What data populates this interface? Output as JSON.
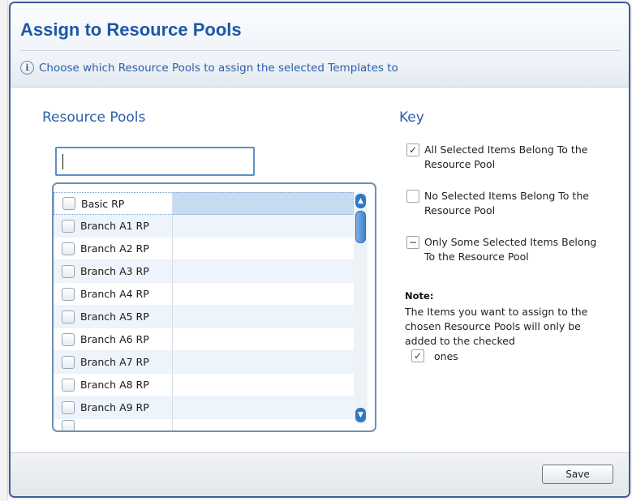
{
  "dialog": {
    "title": "Assign to Resource Pools",
    "info_icon": "info-icon",
    "info_text": "Choose which Resource Pools to assign the selected Templates to"
  },
  "resource_pools": {
    "heading": "Resource Pools",
    "search_value": "",
    "items": [
      {
        "label": "Basic RP",
        "checked": false,
        "selected": true
      },
      {
        "label": "Branch A1 RP",
        "checked": false
      },
      {
        "label": "Branch A2 RP",
        "checked": false
      },
      {
        "label": "Branch A3 RP",
        "checked": false
      },
      {
        "label": "Branch A4 RP",
        "checked": false
      },
      {
        "label": "Branch A5 RP",
        "checked": false
      },
      {
        "label": "Branch A6 RP",
        "checked": false
      },
      {
        "label": "Branch A7 RP",
        "checked": false
      },
      {
        "label": "Branch A8 RP",
        "checked": false
      },
      {
        "label": "Branch A9 RP",
        "checked": false
      }
    ]
  },
  "key": {
    "heading": "Key",
    "items": [
      {
        "symbol": "✓",
        "label": "All Selected Items Belong To the Resource Pool"
      },
      {
        "symbol": "",
        "label": "No Selected Items Belong To the Resource Pool"
      },
      {
        "symbol": "−",
        "label": "Only Some Selected Items Belong To the Resource Pool"
      }
    ]
  },
  "note": {
    "title": "Note:",
    "text": "The Items you want to assign to the chosen Resource Pools will only be added to the checked",
    "check_symbol": "✓",
    "tail": "ones"
  },
  "footer": {
    "save_label": "Save"
  },
  "colors": {
    "accent": "#1f57a6",
    "dialog_border": "#3d5f9a",
    "scroll_blue": "#2f78c9"
  }
}
